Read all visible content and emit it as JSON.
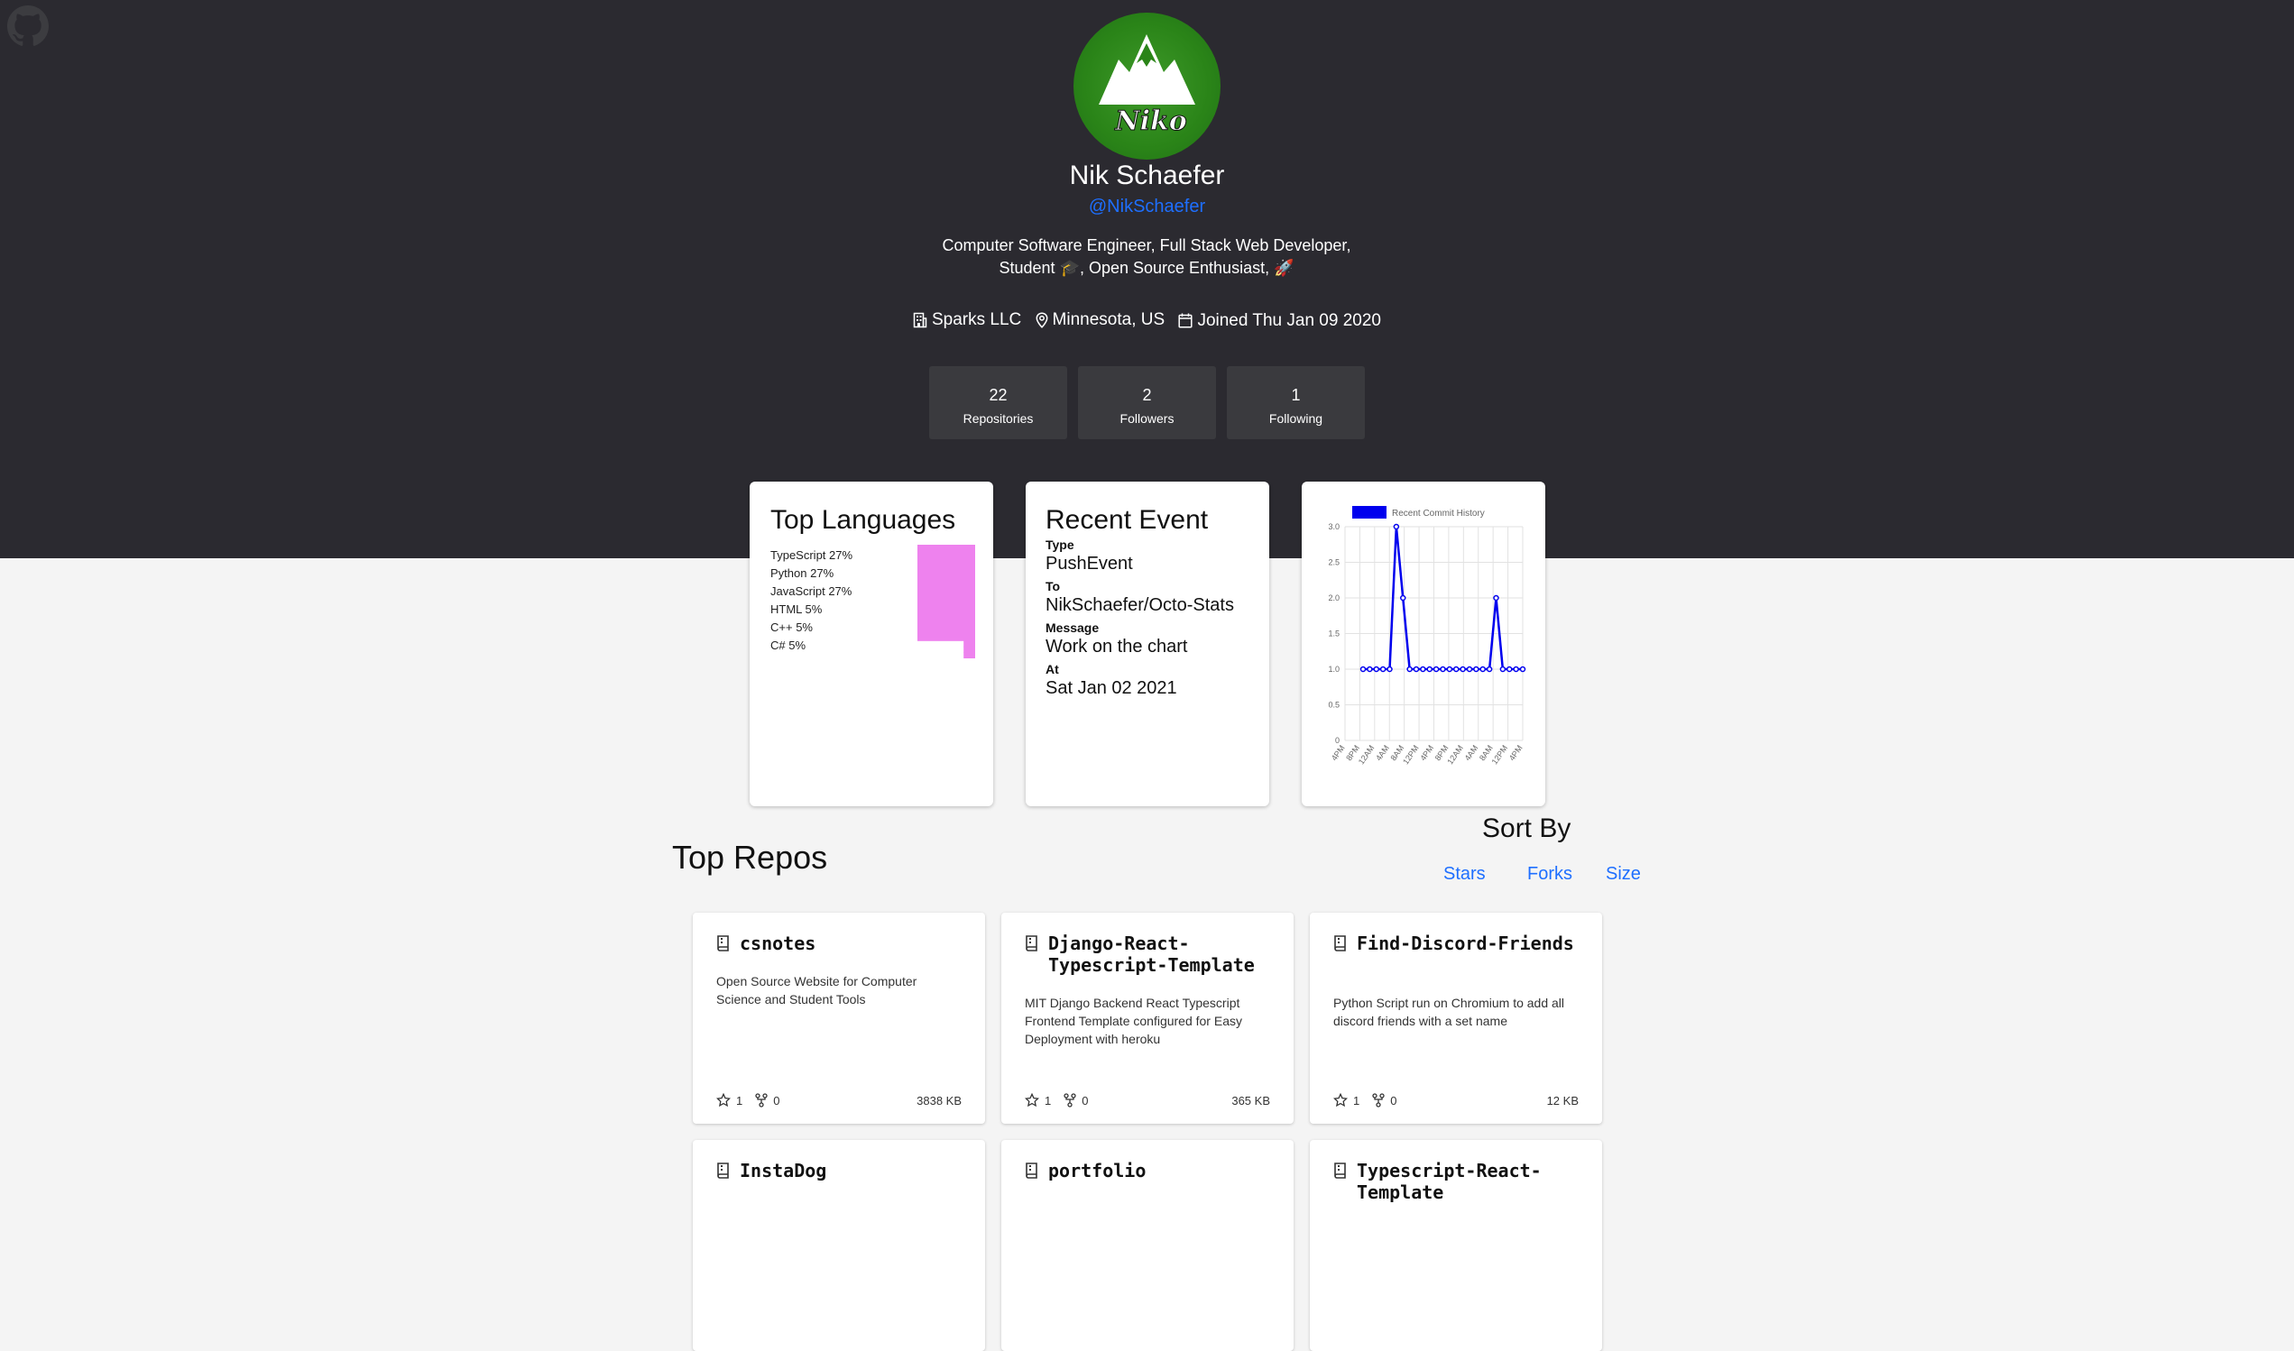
{
  "profile": {
    "name": "Nik Schaefer",
    "handle": "@NikSchaefer",
    "avatar_text": "Niko",
    "bio_line1": "Computer Software Engineer, Full Stack Web Developer,",
    "bio_line2": "Student 🎓, Open Source Enthusiast, 🚀",
    "company": "Sparks LLC",
    "location": "Minnesota, US",
    "joined": "Joined Thu Jan 09 2020"
  },
  "stats": [
    {
      "value": "22",
      "label": "Repositories"
    },
    {
      "value": "2",
      "label": "Followers"
    },
    {
      "value": "1",
      "label": "Following"
    }
  ],
  "languages": {
    "title": "Top Languages",
    "items": [
      {
        "name": "TypeScript",
        "pct": "27%",
        "value": 27
      },
      {
        "name": "Python",
        "pct": "27%",
        "value": 27
      },
      {
        "name": "JavaScript",
        "pct": "27%",
        "value": 27
      },
      {
        "name": "HTML",
        "pct": "5%",
        "value": 5
      },
      {
        "name": "C++",
        "pct": "5%",
        "value": 5
      },
      {
        "name": "C#",
        "pct": "5%",
        "value": 5
      }
    ],
    "bar_color": "#ee82ee"
  },
  "event": {
    "title": "Recent Event",
    "type_label": "Type",
    "type": "PushEvent",
    "to_label": "To",
    "to": "NikSchaefer/Octo-Stats",
    "message_label": "Message",
    "message": "Work on the chart",
    "at_label": "At",
    "at": "Sat Jan 02 2021"
  },
  "chart_data": {
    "type": "line",
    "legend": "Recent Commit History",
    "legend_position": "top",
    "series_color": "#0000ee",
    "x": [
      "4PM",
      "8PM",
      "12AM",
      "4AM",
      "8AM",
      "12PM",
      "4PM",
      "8PM",
      "12AM",
      "4AM",
      "8AM",
      "12PM",
      "4PM"
    ],
    "values": [
      1,
      1,
      1,
      1,
      1,
      3,
      2,
      1,
      1,
      1,
      1,
      1,
      1,
      1,
      1,
      1,
      1,
      1,
      1,
      1,
      2,
      1,
      1,
      1,
      1
    ],
    "yticks": [
      "0",
      "0.5",
      "1.0",
      "1.5",
      "2.0",
      "2.5",
      "3.0"
    ],
    "ylim": [
      0,
      3
    ],
    "grid": true
  },
  "sort": {
    "title": "Sort By",
    "stars": "Stars",
    "forks": "Forks",
    "size": "Size"
  },
  "repos_title": "Top Repos",
  "repos": [
    {
      "name": "csnotes",
      "desc": "Open Source Website for Computer Science and Student Tools",
      "stars": "1",
      "forks": "0",
      "size": "3838 KB"
    },
    {
      "name": "Django-React-Typescript-Template",
      "desc": "MIT Django Backend React Typescript Frontend Template configured for Easy Deployment with heroku",
      "stars": "1",
      "forks": "0",
      "size": "365 KB"
    },
    {
      "name": "Find-Discord-Friends",
      "desc": "Python Script run on Chromium to add all discord friends with a set name",
      "stars": "1",
      "forks": "0",
      "size": "12 KB"
    },
    {
      "name": "InstaDog",
      "desc": "",
      "stars": "",
      "forks": "",
      "size": ""
    },
    {
      "name": "portfolio",
      "desc": "",
      "stars": "",
      "forks": "",
      "size": ""
    },
    {
      "name": "Typescript-React-Template",
      "desc": "",
      "stars": "",
      "forks": "",
      "size": ""
    }
  ]
}
